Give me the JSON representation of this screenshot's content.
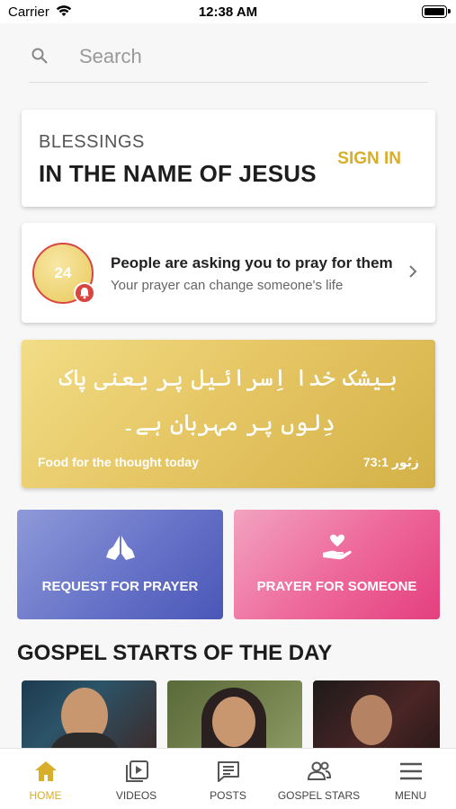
{
  "status_bar": {
    "carrier": "Carrier",
    "time": "12:38 AM"
  },
  "search": {
    "placeholder": "Search"
  },
  "signin_card": {
    "heading": "BLESSINGS",
    "subheading": "IN THE NAME OF JESUS",
    "signin_label": "SIGN IN",
    "accent": "#d8ae2a"
  },
  "prayer_requests": {
    "count": "24",
    "title": "People are asking you to pray for them",
    "subtitle": "Your prayer can change someone's life"
  },
  "verse": {
    "text": "بیشک خدا اِسرائیل پر یعنی پاک دِلوں پر مہربان ہے۔",
    "label": "Food for the thought today",
    "reference": "زبُور 73:1"
  },
  "actions": [
    {
      "label": "REQUEST FOR PRAYER",
      "icon": "praying-hands-icon"
    },
    {
      "label": "PRAYER FOR SOMEONE",
      "icon": "heart-in-hand-icon"
    }
  ],
  "section": {
    "title": "GOSPEL STARTS OF THE DAY"
  },
  "tabs": [
    {
      "label": "HOME",
      "icon": "home-icon",
      "active": true
    },
    {
      "label": "VIDEOS",
      "icon": "video-library-icon",
      "active": false
    },
    {
      "label": "POSTS",
      "icon": "chat-bubble-icon",
      "active": false
    },
    {
      "label": "GOSPEL STARS",
      "icon": "people-icon",
      "active": false
    },
    {
      "label": "MENU",
      "icon": "hamburger-menu-icon",
      "active": false
    }
  ]
}
